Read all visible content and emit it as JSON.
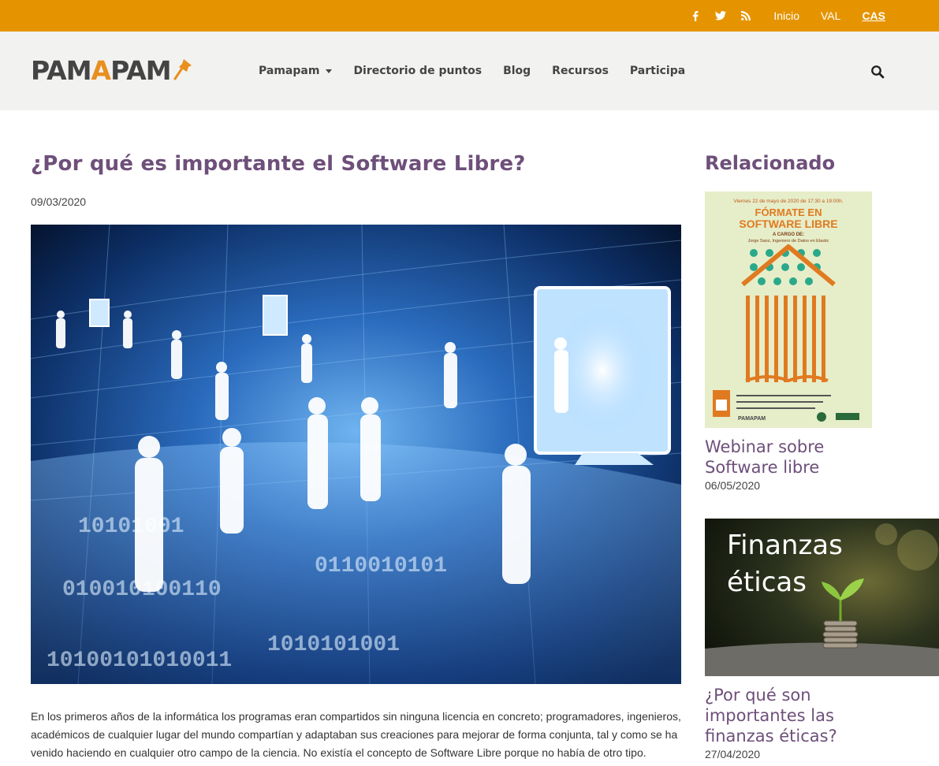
{
  "topbar": {
    "links": [
      {
        "label": "Inicio"
      },
      {
        "label": "VAL"
      },
      {
        "label": "CAS"
      }
    ],
    "icons": [
      "facebook-icon",
      "twitter-icon",
      "rss-icon"
    ],
    "color": "#e59400"
  },
  "logo": {
    "text_prefix": "PAM",
    "text_accent": "A",
    "text_suffix": "PAM"
  },
  "nav": {
    "items": [
      {
        "label": "Pamapam",
        "has_dropdown": true
      },
      {
        "label": "Directorio de puntos"
      },
      {
        "label": "Blog"
      },
      {
        "label": "Recursos"
      },
      {
        "label": "Participa"
      }
    ],
    "search_icon": "search-icon"
  },
  "article": {
    "title": "¿Por qué es importante el Software Libre?",
    "date": "09/03/2020",
    "image_alt_icon": "digital-people-image",
    "body": "En los primeros años de la informática los programas eran compartidos sin ninguna licencia en concreto; programadores, ingenieros, académicos de cualquier lugar del mundo compartían y adaptaban sus creaciones para mejorar de forma conjunta, tal y como se ha venido haciendo en  cualquier otro campo de la ciencia. No existía el concepto de Software Libre porque no había de otro tipo."
  },
  "sidebar": {
    "heading": "Relacionado",
    "cards": [
      {
        "title": "Webinar sobre Software libre",
        "date": "06/05/2020",
        "poster": {
          "top": "Viernes 22 de mayo de 2020 de 17:30 a 19:00h.",
          "line1": "FÓRMATE EN",
          "line2": "SOFTWARE LIBRE",
          "cargo": "A CARGO DE:",
          "speaker": "Jorge Sanz, Ingeniero de Datos en Elastic",
          "brand": "PAMAPAM"
        }
      },
      {
        "title": "¿Por qué son importantes las finanzas éticas?",
        "date": "27/04/2020",
        "image_text_1": "Finanzas",
        "image_text_2": "éticas"
      }
    ]
  },
  "colors": {
    "accent_orange": "#e59400",
    "heading_purple": "#6e4f7a",
    "nav_bg": "#f2f2f0"
  }
}
